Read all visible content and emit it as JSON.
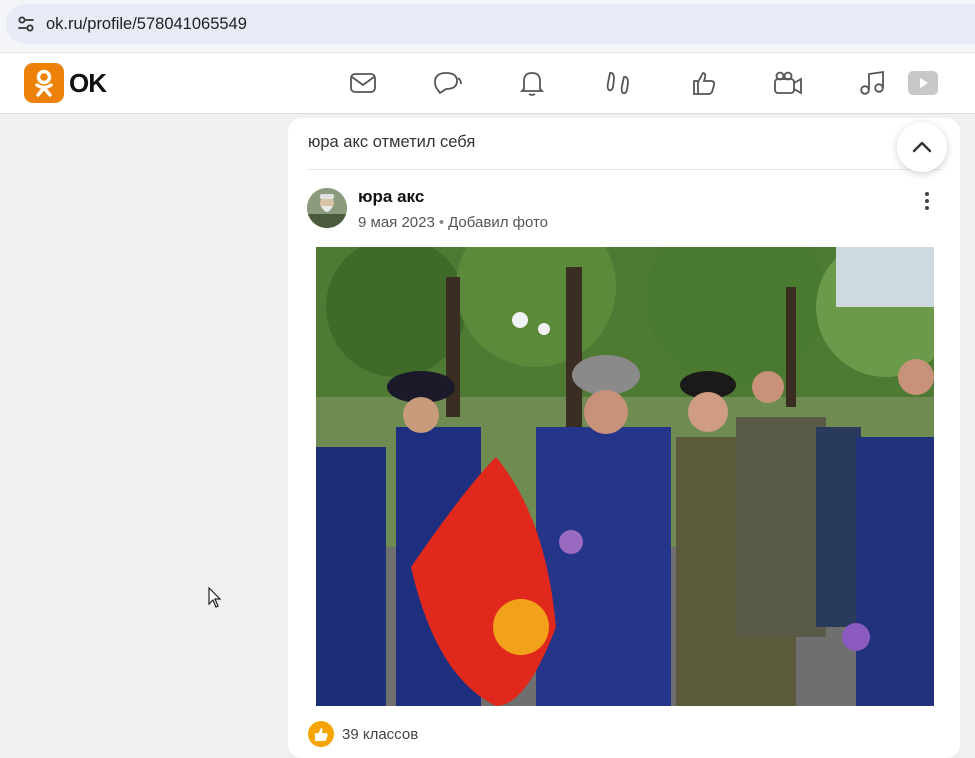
{
  "browser": {
    "url": "ok.ru/profile/578041065549"
  },
  "header": {
    "logo_text": "OK",
    "nav": [
      {
        "icon": "messages-icon"
      },
      {
        "icon": "discussions-icon"
      },
      {
        "icon": "notifications-icon"
      },
      {
        "icon": "guests-icon"
      },
      {
        "icon": "reactions-icon"
      },
      {
        "icon": "video-icon"
      },
      {
        "icon": "music-icon"
      },
      {
        "icon": "play-icon"
      }
    ]
  },
  "feed": {
    "header_text": "юра акс отметил себя",
    "post": {
      "author": "юра акс",
      "date": "9 мая 2023",
      "separator": "•",
      "action": "Добавил фото",
      "likes": "39 классов"
    }
  },
  "colors": {
    "brand": "#ee8208",
    "like": "#f7a400"
  }
}
